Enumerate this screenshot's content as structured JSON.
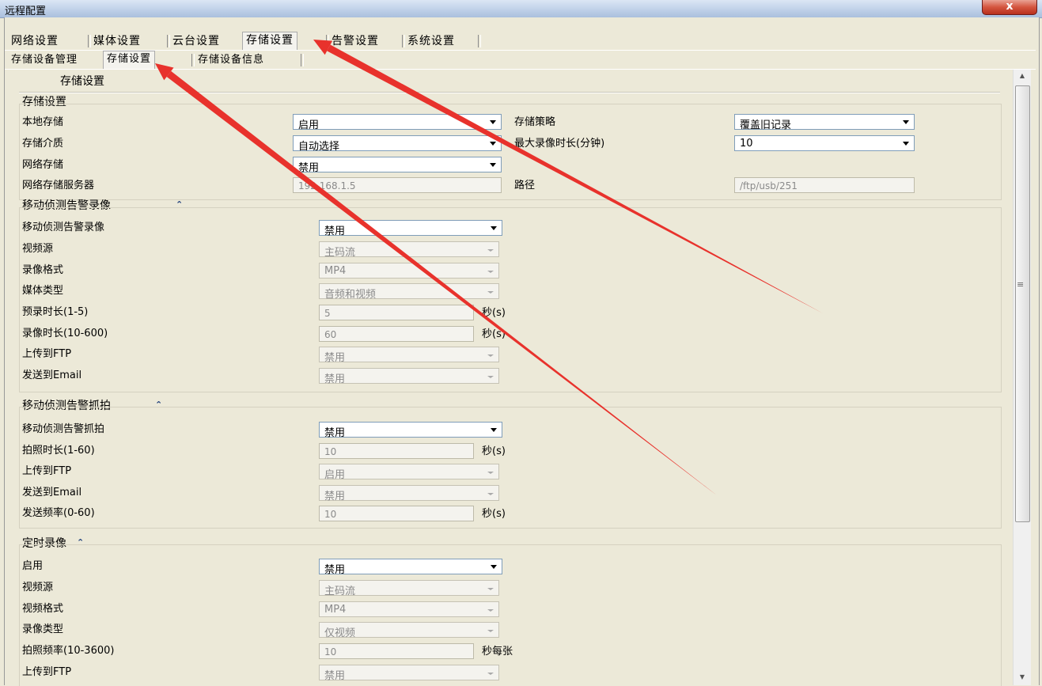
{
  "window": {
    "title": "远程配置",
    "close_label": "x"
  },
  "main_tabs": [
    {
      "label": "网络设置"
    },
    {
      "label": "媒体设置"
    },
    {
      "label": "云台设置"
    },
    {
      "label": "存储设置"
    },
    {
      "label": "告警设置"
    },
    {
      "label": "系统设置"
    }
  ],
  "main_tab_selected": "存储设置",
  "sub_tabs": [
    {
      "label": "存储设备管理"
    },
    {
      "label": "存储设置"
    },
    {
      "label": "存储设备信息"
    }
  ],
  "sub_tab_selected": "存储设置",
  "page_heading": "存储设置",
  "storage": {
    "section_title": "存储设置",
    "local_storage": {
      "label": "本地存储",
      "value": "启用"
    },
    "medium": {
      "label": "存储介质",
      "value": "自动选择"
    },
    "network_storage": {
      "label": "网络存储",
      "value": "禁用"
    },
    "server": {
      "label": "网络存储服务器",
      "value": "192.168.1.5"
    },
    "policy": {
      "label": "存储策略",
      "value": "覆盖旧记录"
    },
    "max_duration": {
      "label": "最大录像时长(分钟)",
      "value": "10"
    },
    "path": {
      "label": "路径",
      "value": "/ftp/usb/251"
    }
  },
  "motion_record": {
    "section_title": "移动侦测告警录像",
    "enable": {
      "label": "移动侦测告警录像",
      "value": "禁用"
    },
    "source": {
      "label": "视频源",
      "value": "主码流"
    },
    "format": {
      "label": "录像格式",
      "value": "MP4"
    },
    "media_type": {
      "label": "媒体类型",
      "value": "音频和视频"
    },
    "prerecord": {
      "label": "预录时长(1-5)",
      "value": "5",
      "unit": "秒(s)"
    },
    "duration": {
      "label": "录像时长(10-600)",
      "value": "60",
      "unit": "秒(s)"
    },
    "ftp": {
      "label": "上传到FTP",
      "value": "禁用"
    },
    "email": {
      "label": "发送到Email",
      "value": "禁用"
    }
  },
  "motion_snap": {
    "section_title": "移动侦测告警抓拍",
    "enable": {
      "label": "移动侦测告警抓拍",
      "value": "禁用"
    },
    "duration": {
      "label": "拍照时长(1-60)",
      "value": "10",
      "unit": "秒(s)"
    },
    "ftp": {
      "label": "上传到FTP",
      "value": "启用"
    },
    "email": {
      "label": "发送到Email",
      "value": "禁用"
    },
    "frequency": {
      "label": "发送频率(0-60)",
      "value": "10",
      "unit": "秒(s)"
    }
  },
  "timed_record": {
    "section_title": "定时录像",
    "enable": {
      "label": "启用",
      "value": "禁用"
    },
    "source": {
      "label": "视频源",
      "value": "主码流"
    },
    "format": {
      "label": "视频格式",
      "value": "MP4"
    },
    "record_type": {
      "label": "录像类型",
      "value": "仅视频"
    },
    "snap_freq": {
      "label": "拍照频率(10-3600)",
      "value": "10",
      "unit": "秒每张"
    },
    "ftp": {
      "label": "上传到FTP",
      "value": "禁用"
    }
  },
  "annotation": {
    "arrow_color": "#e8322c"
  }
}
